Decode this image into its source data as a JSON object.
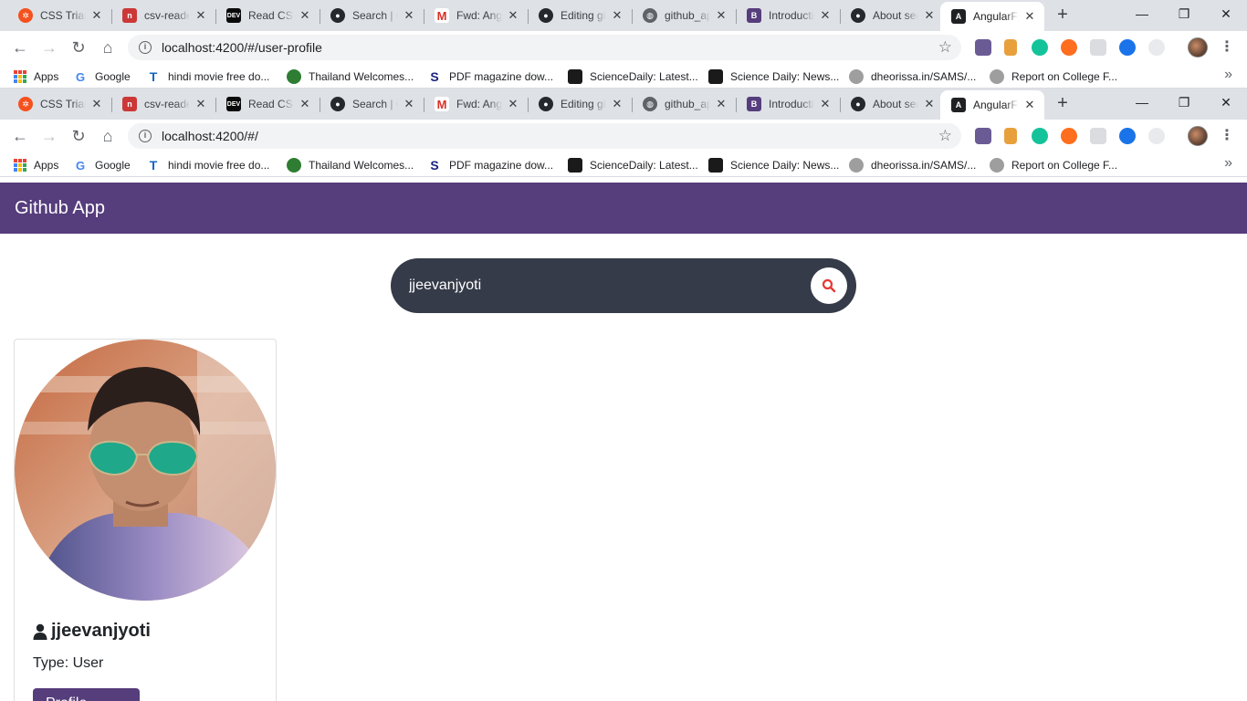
{
  "browser_windows": [
    {
      "tabs": [
        {
          "title": "CSS Triangles",
          "favicon": "codepen-icon",
          "color": "#f4511e"
        },
        {
          "title": "csv-reader",
          "favicon": "npm-icon",
          "color": "#cb3837"
        },
        {
          "title": "Read CSV",
          "favicon": "dev-icon",
          "color": "#0a0a0a"
        },
        {
          "title": "Search | GitHub",
          "favicon": "github-icon",
          "color": "#24292e"
        },
        {
          "title": "Fwd: Angular",
          "favicon": "gmail-icon",
          "color": "#d93025"
        },
        {
          "title": "Editing github",
          "favicon": "github-icon",
          "color": "#24292e"
        },
        {
          "title": "github_app",
          "favicon": "globe-icon",
          "color": "#5f6368"
        },
        {
          "title": "Introduction",
          "favicon": "bootstrap-icon",
          "color": "#563d7c"
        },
        {
          "title": "About search",
          "favicon": "github-icon",
          "color": "#24292e"
        },
        {
          "title": "AngularFire",
          "favicon": "angular-icon",
          "color": "#202124",
          "active": true
        }
      ],
      "url": "localhost:4200/#/user-profile"
    },
    {
      "tabs": [
        {
          "title": "CSS Triangles",
          "favicon": "codepen-icon",
          "color": "#f4511e"
        },
        {
          "title": "csv-reader",
          "favicon": "npm-icon",
          "color": "#cb3837"
        },
        {
          "title": "Read CSV",
          "favicon": "dev-icon",
          "color": "#0a0a0a"
        },
        {
          "title": "Search | GitHub",
          "favicon": "github-icon",
          "color": "#24292e"
        },
        {
          "title": "Fwd: Angular",
          "favicon": "gmail-icon",
          "color": "#d93025"
        },
        {
          "title": "Editing github",
          "favicon": "github-icon",
          "color": "#24292e"
        },
        {
          "title": "github_app",
          "favicon": "globe-icon",
          "color": "#5f6368"
        },
        {
          "title": "Introduction",
          "favicon": "bootstrap-icon",
          "color": "#563d7c"
        },
        {
          "title": "About search",
          "favicon": "github-icon",
          "color": "#24292e"
        },
        {
          "title": "AngularFire",
          "favicon": "angular-icon",
          "color": "#202124",
          "active": true
        }
      ],
      "url": "localhost:4200/#/"
    }
  ],
  "bookmarks": [
    {
      "label": "Apps",
      "icon": "apps-grid-icon"
    },
    {
      "label": "Google",
      "icon": "google-icon"
    },
    {
      "label": "hindi movie free do...",
      "icon": "tz-icon"
    },
    {
      "label": "Thailand Welcomes...",
      "icon": "globe-icon"
    },
    {
      "label": "PDF magazine dow...",
      "icon": "pdf-s-icon"
    },
    {
      "label": "ScienceDaily: Latest...",
      "icon": "sciencedaily-icon"
    },
    {
      "label": "Science Daily: News...",
      "icon": "sciencedaily-icon"
    },
    {
      "label": "dheorissa.in/SAMS/...",
      "icon": "sams-icon"
    },
    {
      "label": "Report on College F...",
      "icon": "sams-icon"
    }
  ],
  "app": {
    "brand": "Github App",
    "brand_color": "#563d7c",
    "search": {
      "value": "jjeevanjyoti",
      "icon": "search-icon",
      "icon_color": "#e53935"
    },
    "profile": {
      "username": "jjeevanjyoti",
      "type_line": "Type: User",
      "button_label": "Profile"
    }
  }
}
